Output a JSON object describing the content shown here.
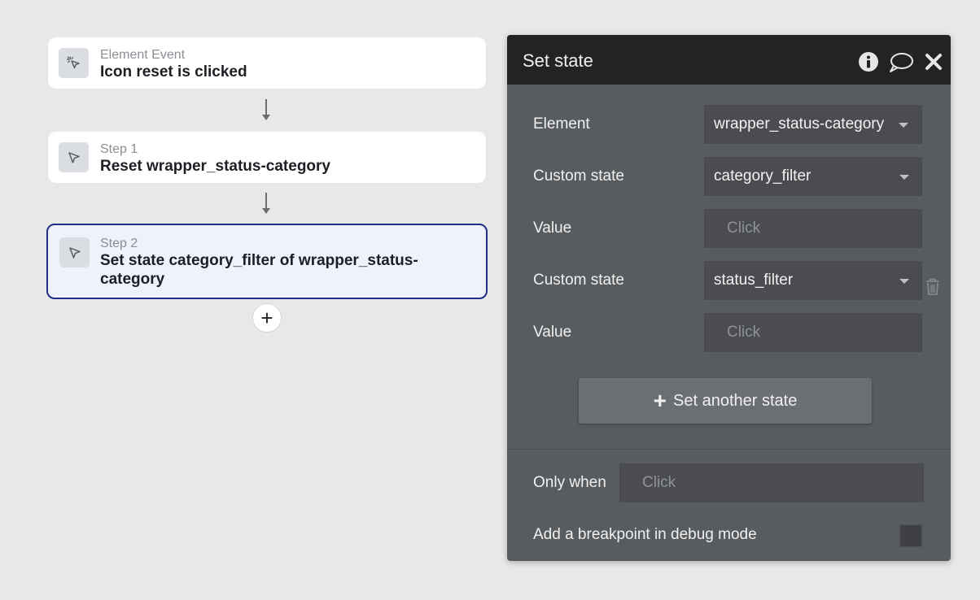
{
  "workflow": {
    "event": {
      "kind": "Element Event",
      "title": "Icon reset is clicked",
      "icon": "cursor-click-icon"
    },
    "steps": [
      {
        "kind": "Step 1",
        "title": "Reset wrapper_status-category",
        "icon": "cursor-arrow-icon"
      },
      {
        "kind": "Step 2",
        "title": "Set state category_filter of wrapper_status-category",
        "icon": "cursor-arrow-icon"
      }
    ],
    "add_step_symbol": "+"
  },
  "panel": {
    "title": "Set state",
    "header_icons": [
      "info-icon",
      "comment-icon",
      "close-icon"
    ],
    "rows": [
      {
        "label": "Element",
        "value": "wrapper_status-category",
        "type": "dropdown"
      },
      {
        "label": "Custom state",
        "value": "category_filter",
        "type": "dropdown"
      },
      {
        "label": "Value",
        "value": "Click",
        "type": "expression"
      },
      {
        "label": "Custom state",
        "value": "status_filter",
        "type": "dropdown"
      },
      {
        "label": "Value",
        "value": "Click",
        "type": "expression"
      }
    ],
    "set_another_label": "Set another state",
    "only_when_label": "Only when",
    "only_when_value": "Click",
    "breakpoint_label": "Add a breakpoint in debug mode",
    "breakpoint_checked": false
  },
  "colors": {
    "selected_border": "#1d2f87",
    "selected_bg": "#edf2fc",
    "panel_bg": "#595c5f",
    "panel_header": "#222325",
    "field_bg": "#4a4c4f"
  }
}
